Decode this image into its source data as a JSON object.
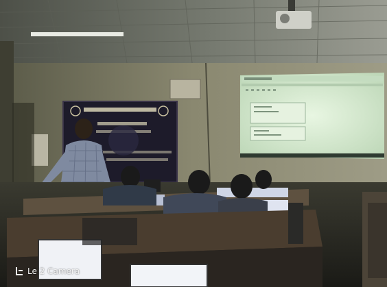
{
  "watermark": {
    "text": "Le 2 Camera",
    "logo_icon": "le-logo-icon"
  },
  "colors": {
    "projection": "#d8ead0",
    "ceiling": "#6f7268",
    "wall": "#8a8870"
  }
}
